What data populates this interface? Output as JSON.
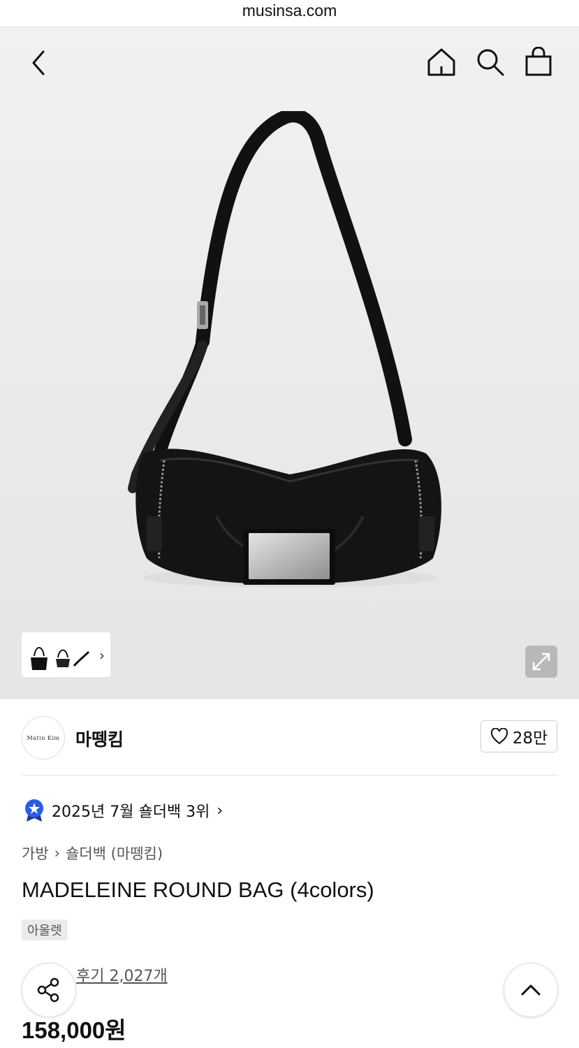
{
  "browser": {
    "url": "musinsa.com"
  },
  "header": {
    "back_icon": "chevron-left-icon",
    "home_icon": "home-icon",
    "search_icon": "search-icon",
    "cart_icon": "shopping-bag-icon"
  },
  "gallery": {
    "thumbnail_more": "›",
    "expand_icon": "expand-icon"
  },
  "brand": {
    "logo_text": "Matin  Kim",
    "name": "마뗑킴",
    "like_count": "28만"
  },
  "ranking": {
    "text": "2025년 7월 숄더백 3위",
    "arrow": "›"
  },
  "breadcrumb": {
    "category": "가방",
    "separator": "›",
    "subcategory": "숄더백 (마뗑킴)"
  },
  "product": {
    "title": "MADELEINE ROUND BAG (4colors)",
    "badge": "아울렛",
    "review_link": "후기 2,027개",
    "price": "158,000원"
  },
  "colors": {
    "accent": "#2b5ce6",
    "star": "#f5a623"
  }
}
